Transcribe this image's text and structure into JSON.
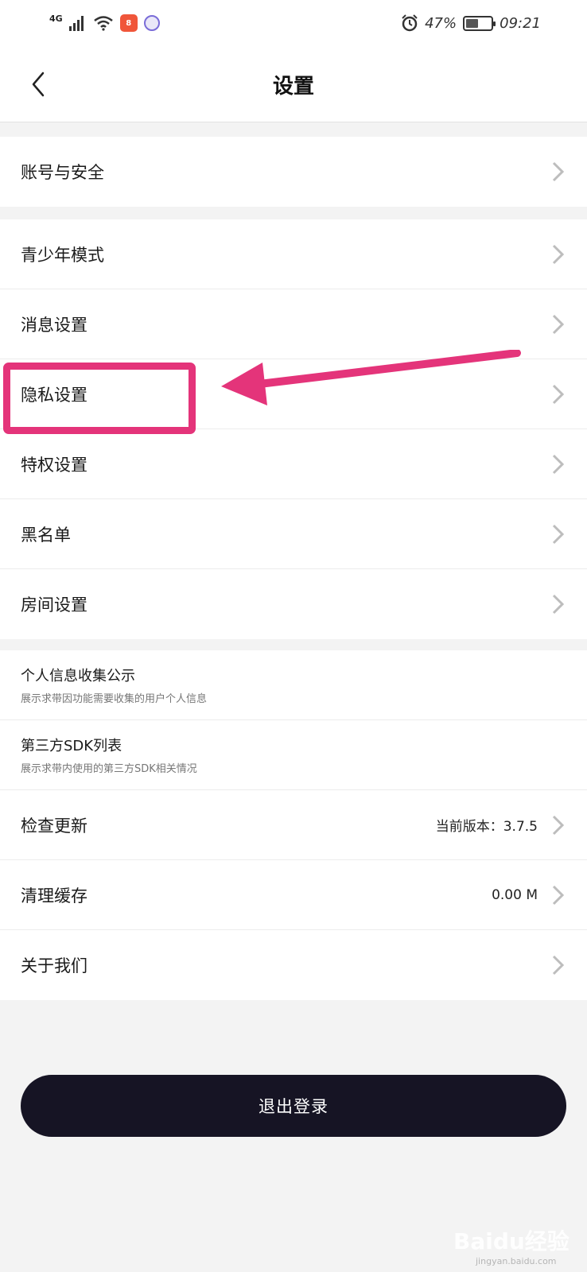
{
  "status_bar": {
    "network": "4G",
    "battery": "47%",
    "battery_fraction": 0.47,
    "time": "09:21",
    "app_icon_1": "8",
    "icons": [
      "signal-icon",
      "wifi-icon",
      "alarm-icon",
      "battery-icon"
    ]
  },
  "header": {
    "title": "设置"
  },
  "groups": {
    "account": [
      "账号与安全"
    ],
    "main": [
      "青少年模式",
      "消息设置",
      "隐私设置",
      "特权设置",
      "黑名单",
      "房间设置"
    ],
    "info": [
      {
        "title": "个人信息收集公示",
        "subtitle": "展示求带因功能需要收集的用户个人信息"
      },
      {
        "title": "第三方SDK列表",
        "subtitle": "展示求带内使用的第三方SDK相关情况"
      }
    ],
    "system": [
      {
        "label": "检查更新",
        "value": "当前版本：3.7.5"
      },
      {
        "label": "清理缓存",
        "value": "0.00 M"
      },
      {
        "label": "关于我们",
        "value": ""
      }
    ]
  },
  "logout_label": "退出登录",
  "watermark": {
    "text": "Baidu经验",
    "sub": "jingyan.baidu.com"
  },
  "colors": {
    "annotation": "#e4347a",
    "logout_bg": "#161424",
    "chevron": "#bdbdbd"
  }
}
